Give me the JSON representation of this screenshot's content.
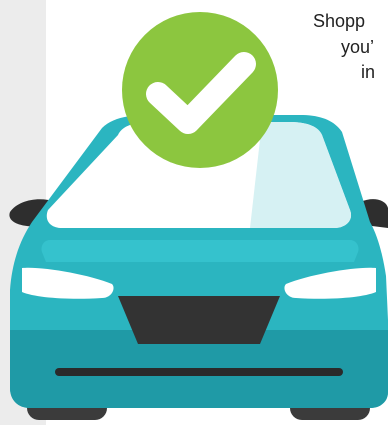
{
  "content": {
    "text_lines": [
      "Shopp",
      "you’",
      "in"
    ]
  },
  "icons": {
    "badge": "checkmark-icon",
    "vehicle": "car-icon"
  },
  "colors": {
    "check_badge": "#8cc63f",
    "car_body": "#2bb5c0",
    "car_body_shade": "#1f9aa6",
    "tires": "#3b3b3b",
    "side_strip": "#ececec"
  }
}
